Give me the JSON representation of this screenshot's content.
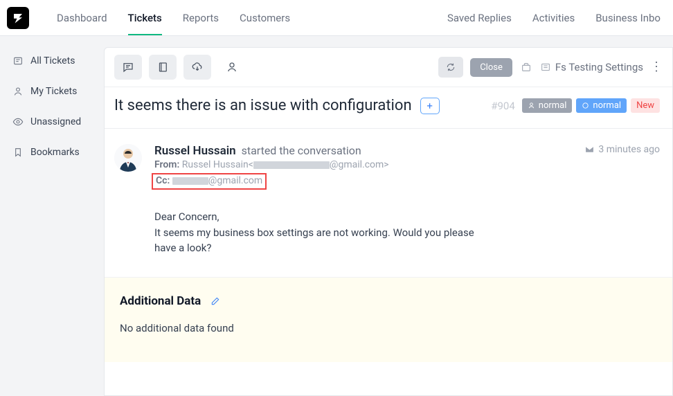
{
  "nav": {
    "items": [
      "Dashboard",
      "Tickets",
      "Reports",
      "Customers"
    ],
    "right": [
      "Saved Replies",
      "Activities",
      "Business Inbo"
    ]
  },
  "sidebar": {
    "items": [
      {
        "label": "All Tickets"
      },
      {
        "label": "My Tickets"
      },
      {
        "label": "Unassigned"
      },
      {
        "label": "Bookmarks"
      }
    ]
  },
  "toolbar": {
    "close": "Close",
    "inbox": "Fs Testing Settings"
  },
  "ticket": {
    "subject": "It seems there is an issue with configuration",
    "id": "#904",
    "priority": "normal",
    "status": "normal",
    "tag": "New"
  },
  "message": {
    "sender": "Russel Hussain",
    "action": "started the conversation",
    "from_label": "From:",
    "from_name": "Russel Hussain",
    "from_suffix": "@gmail.com>",
    "cc_label": "Cc:",
    "cc_suffix": "@gmail.com",
    "time": "3 minutes ago",
    "body_line1": "Dear Concern,",
    "body_line2": "It seems my business box settings are not working. Would you please have a look?"
  },
  "additional": {
    "title": "Additional Data",
    "empty": "No additional data found"
  }
}
